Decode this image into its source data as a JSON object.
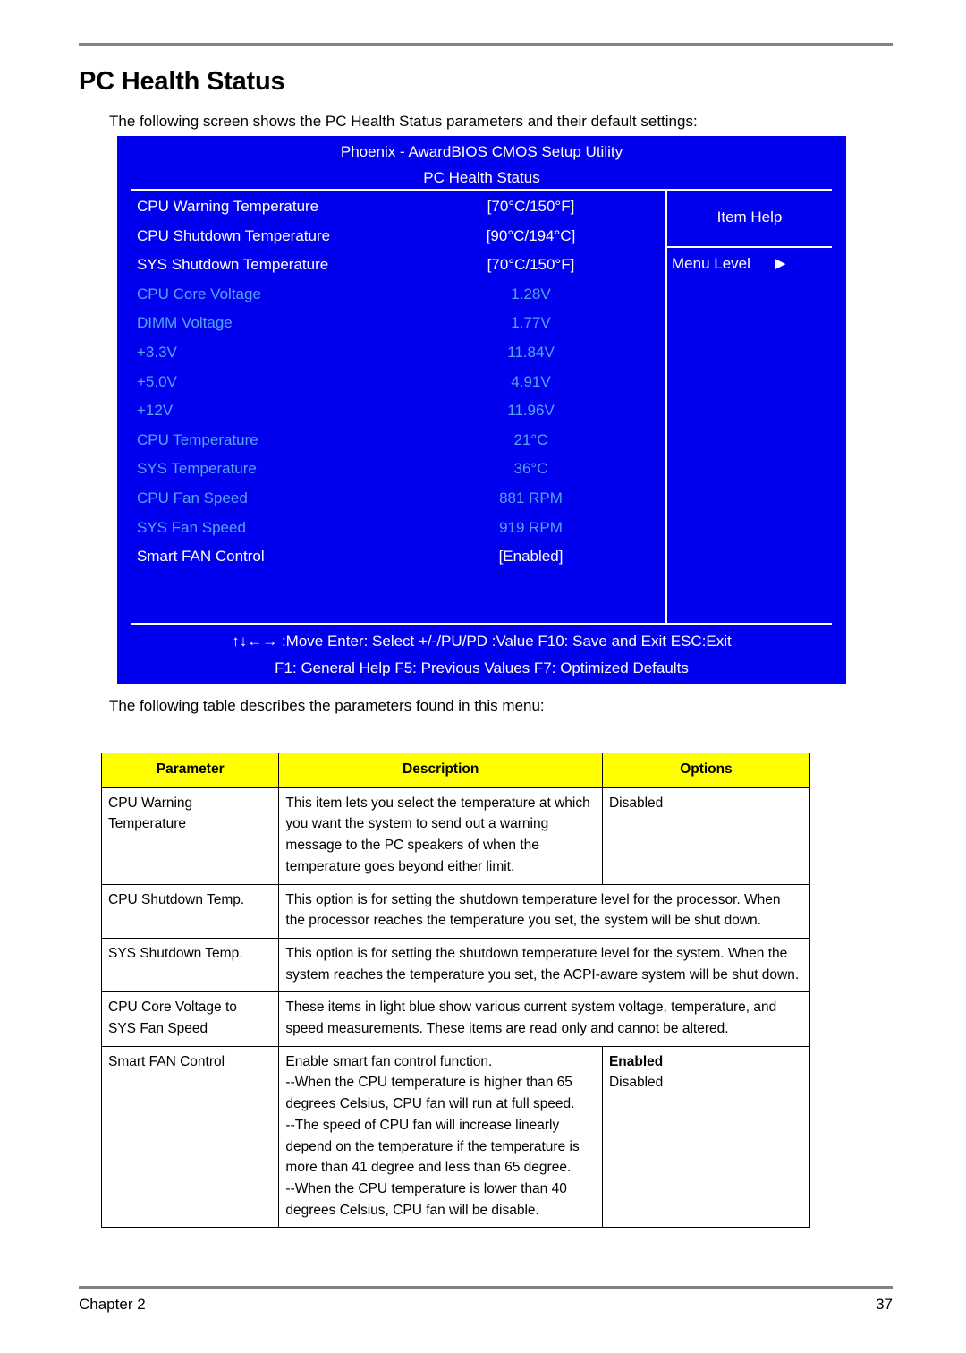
{
  "page": {
    "title": "PC Health Status",
    "intro_screen": "The following screen shows the PC Health Status parameters and their default settings:",
    "intro_table": "The following table describes the parameters found in this menu:",
    "footer_chapter": "Chapter 2",
    "footer_page": "37"
  },
  "bios": {
    "utility_title": "Phoenix - AwardBIOS CMOS Setup Utility",
    "menu_title": "PC Health Status",
    "colors": {
      "background": "#0000ee",
      "text": "#ffffff",
      "measurement": "#55a5f5"
    },
    "rows": [
      {
        "label": "CPU Warning Temperature",
        "value": "[70°C/150°F]",
        "readonly": false
      },
      {
        "label": "CPU Shutdown Temperature",
        "value": "[90°C/194°C]",
        "readonly": false
      },
      {
        "label": "SYS Shutdown Temperature",
        "value": "[70°C/150°F]",
        "readonly": false
      },
      {
        "label": "CPU Core Voltage",
        "value": "1.28V",
        "readonly": true
      },
      {
        "label": "DIMM Voltage",
        "value": "1.77V",
        "readonly": true
      },
      {
        "label": "+3.3V",
        "value": "11.84V",
        "readonly": true
      },
      {
        "label": "+5.0V",
        "value": "4.91V",
        "readonly": true
      },
      {
        "label": "+12V",
        "value": "11.96V",
        "readonly": true
      },
      {
        "label": "CPU Temperature",
        "value": "21°C",
        "readonly": true
      },
      {
        "label": "SYS Temperature",
        "value": "36°C",
        "readonly": true
      },
      {
        "label": "CPU Fan Speed",
        "value": "881 RPM",
        "readonly": true
      },
      {
        "label": "SYS Fan Speed",
        "value": "919 RPM",
        "readonly": true
      },
      {
        "label": "Smart FAN Control",
        "value": "[Enabled]",
        "readonly": false
      }
    ],
    "help": {
      "header": "Item Help",
      "menu_level_label": "Menu Level",
      "menu_level_arrow": "▶"
    },
    "nav_line_1": "↑↓←→ :Move  Enter: Select   +/-/PU/PD :Value  F10: Save and Exit ESC:Exit",
    "nav_line_2": "F1: General Help   F5: Previous Values   F7: Optimized Defaults"
  },
  "table": {
    "headers": [
      "Parameter",
      "Description",
      "Options"
    ],
    "header_bg": "#ffff00",
    "rows": [
      {
        "parameter": "CPU Warning\nTemperature",
        "description": "This item lets you select the temperature at which you want the system to send out a warning message to the PC speakers of when the temperature goes beyond either limit.",
        "options": [
          "Disabled"
        ],
        "options_bold": []
      },
      {
        "parameter": "CPU Shutdown Temp.",
        "description": "This option is for setting the shutdown temperature level for the processor. When the processor reaches the temperature you set, the system will be shut down.",
        "options": [],
        "options_bold": [],
        "description_spans_options": true
      },
      {
        "parameter": "SYS Shutdown Temp.",
        "description": "This option is for setting the shutdown temperature level for the system. When the system reaches the temperature you set, the ACPI-aware system will be shut down.",
        "options": [],
        "options_bold": [],
        "description_spans_options": true
      },
      {
        "parameter": "CPU Core Voltage to\nSYS Fan Speed",
        "description": "These items in light blue show various current system voltage, temperature, and speed measurements. These items are read only and cannot be altered.",
        "options": [],
        "options_bold": [],
        "description_spans_options": true
      },
      {
        "parameter": "Smart FAN Control",
        "description": "Enable smart fan control function.\n--When the CPU temperature is higher than 65\ndegrees Celsius, CPU fan will run at full speed.\n--The speed of CPU fan will increase linearly\ndepend on the temperature if the temperature is\nmore than 41 degree and less than 65 degree.\n--When the CPU temperature is lower than 40\ndegrees Celsius, CPU fan will be disable.",
        "options": [
          "Disabled"
        ],
        "options_bold": [
          "Enabled"
        ]
      }
    ]
  }
}
